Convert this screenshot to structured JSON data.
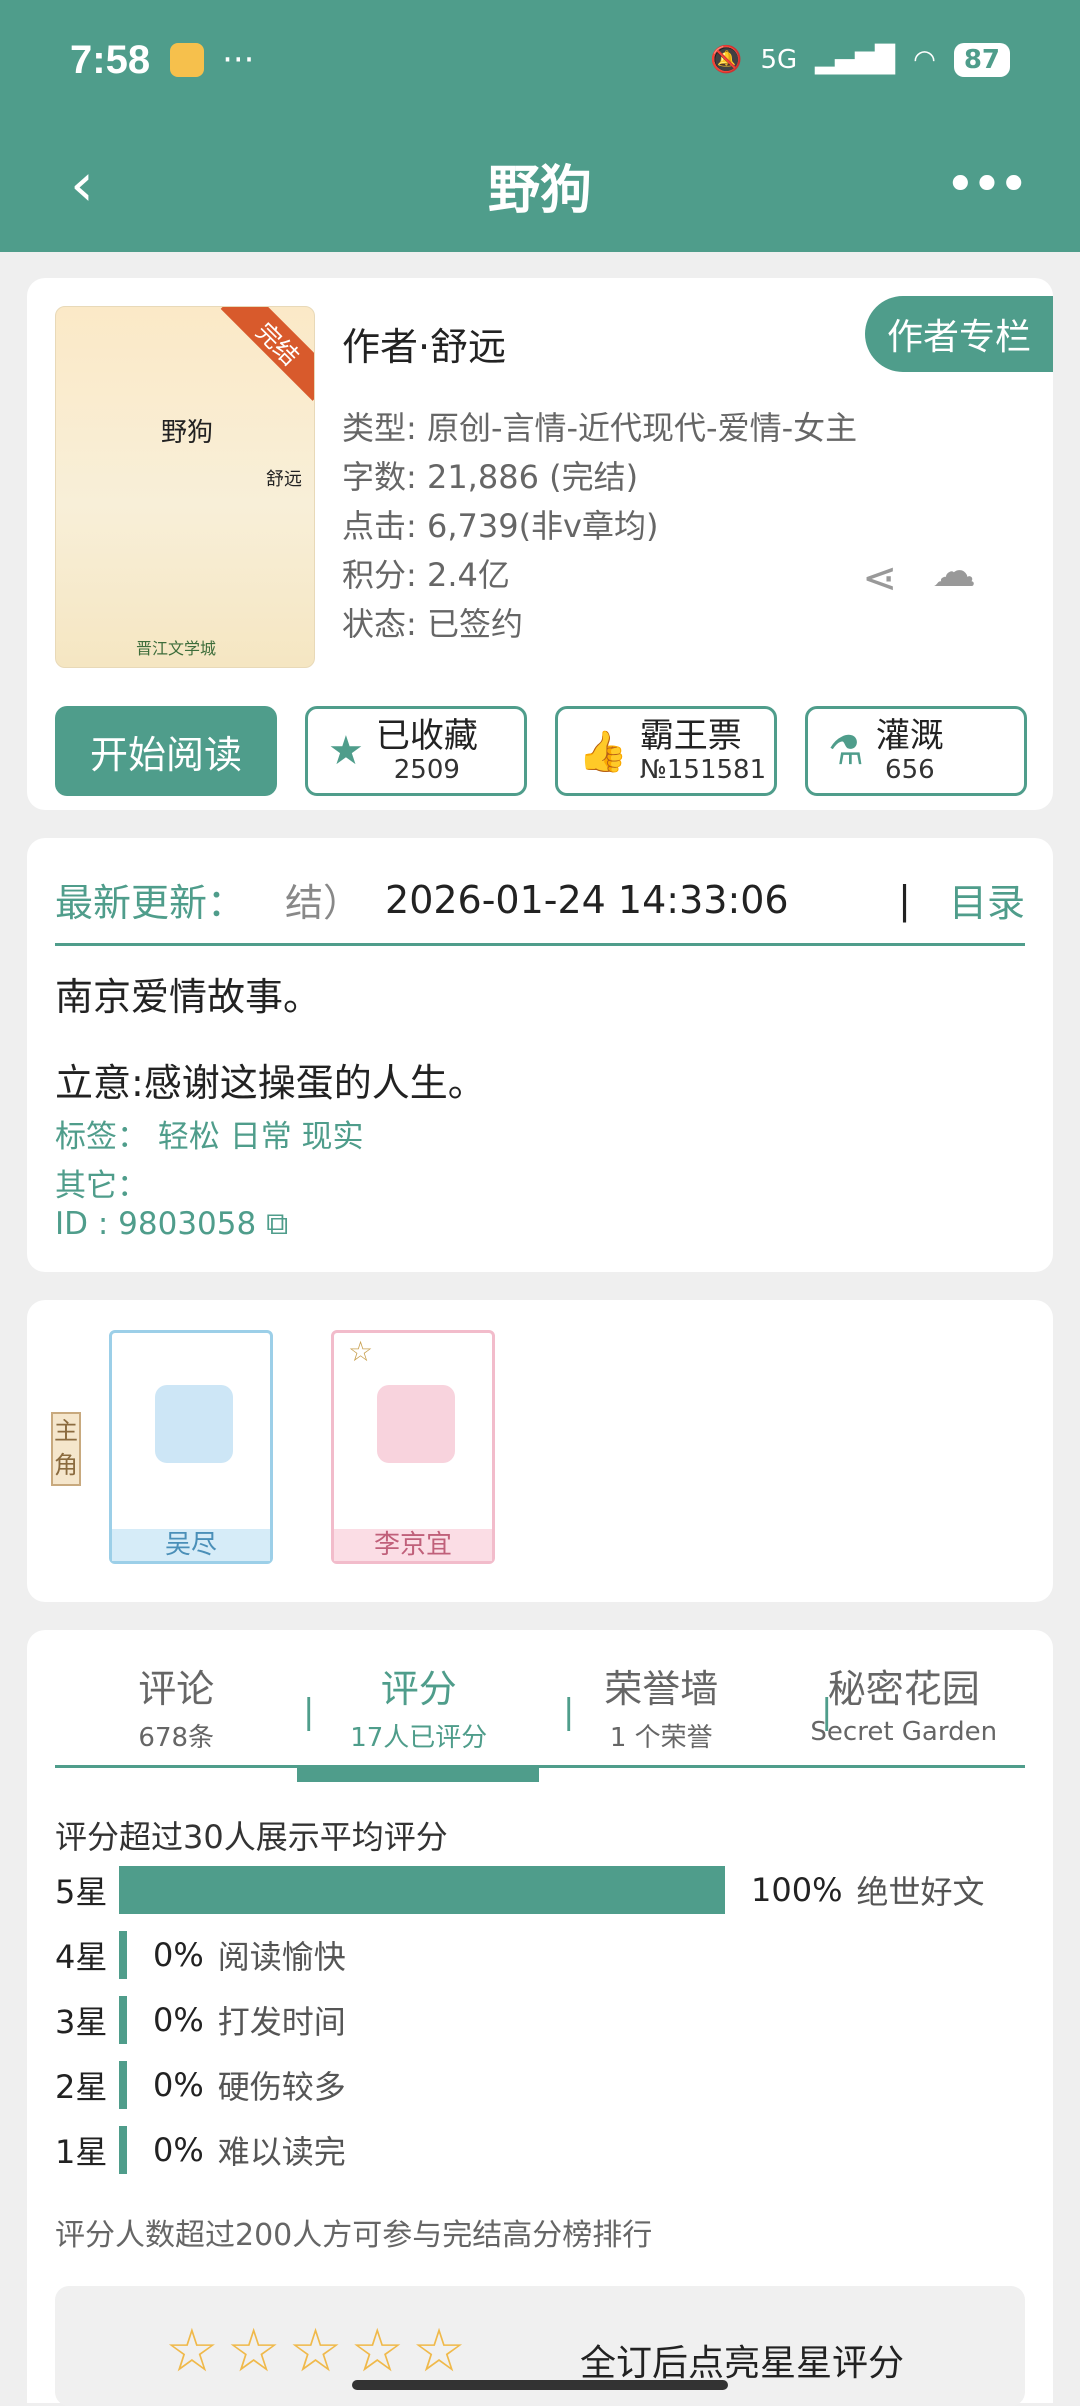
{
  "status": {
    "time": "7:58",
    "dots": "···",
    "net": "5G",
    "battery": "87"
  },
  "nav": {
    "back": "‹",
    "title": "野狗",
    "more": "•••"
  },
  "book": {
    "cover_title": "野狗",
    "cover_author": "舒远",
    "cover_badge": "完结",
    "cover_logo": "晋江文学城",
    "author": "作者·舒远",
    "author_column": "作者专栏",
    "meta": [
      "类型: 原创-言情-近代现代-爱情-女主",
      "字数: 21,886 (完结)",
      "点击: 6,739(非v章均)",
      "积分: 2.4亿",
      "状态: 已签约"
    ],
    "actions": {
      "read": "开始阅读",
      "fav": {
        "label": "已收藏",
        "count": "2509"
      },
      "ticket": {
        "label": "霸王票",
        "count": "№151581"
      },
      "water": {
        "label": "灌溉",
        "count": "656"
      }
    }
  },
  "update": {
    "label": "最新更新：",
    "chapter": "结）",
    "time": "2026-01-24 14:33:06",
    "sep": "|",
    "toc": "目录",
    "summary": "南京爱情故事。",
    "idea": "立意:感谢这操蛋的人生。",
    "tags": "标签：  轻松  日常  现实",
    "other": "其它：",
    "id": "ID    :   9803058"
  },
  "roles": {
    "tag": "主角",
    "items": [
      {
        "name": "吴尽"
      },
      {
        "name": "李京宜"
      }
    ]
  },
  "tabs": [
    {
      "label": "评论",
      "sub": "678条"
    },
    {
      "label": "评分",
      "sub": "17人已评分"
    },
    {
      "label": "荣誉墙",
      "sub": "1 个荣誉"
    },
    {
      "label": "秘密花园",
      "sub": "Secret Garden"
    }
  ],
  "rating": {
    "note": "评分超过30人展示平均评分",
    "rows": [
      {
        "star": "5星",
        "percent": "100%",
        "label": "绝世好文",
        "fraction": 1.0
      },
      {
        "star": "4星",
        "percent": "0%",
        "label": "阅读愉快",
        "fraction": 0
      },
      {
        "star": "3星",
        "percent": "0%",
        "label": "打发时间",
        "fraction": 0
      },
      {
        "star": "2星",
        "percent": "0%",
        "label": "硬伤较多",
        "fraction": 0
      },
      {
        "star": "1星",
        "percent": "0%",
        "label": "难以读完",
        "fraction": 0
      }
    ],
    "footer": "评分人数超过200人方可参与完结高分榜排行",
    "stars": "☆☆☆☆☆",
    "star_tip": "全订后点亮星星评分"
  },
  "colors": {
    "accent": "#4f9d8b"
  }
}
